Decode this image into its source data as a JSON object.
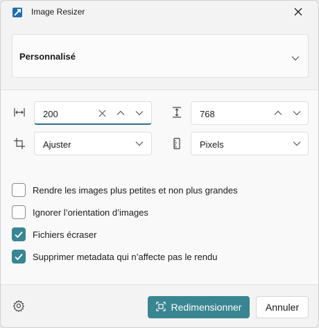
{
  "window": {
    "title": "Image Resizer"
  },
  "preset": {
    "selected": "Personnalisé"
  },
  "size": {
    "width_value": "200",
    "height_value": "768",
    "fit_mode": "Ajuster",
    "unit": "Pixels"
  },
  "options": [
    {
      "label": "Rendre les images plus petites et non plus grandes",
      "checked": false
    },
    {
      "label": "Ignorer l’orientation d’images",
      "checked": false
    },
    {
      "label": "Fichiers écraser",
      "checked": true
    },
    {
      "label": "Supprimer metadata qui n’affecte pas le rendu",
      "checked": true
    }
  ],
  "actions": {
    "resize_label": "Redimensionner",
    "cancel_label": "Annuler"
  },
  "colors": {
    "accent": "#3a8592"
  }
}
